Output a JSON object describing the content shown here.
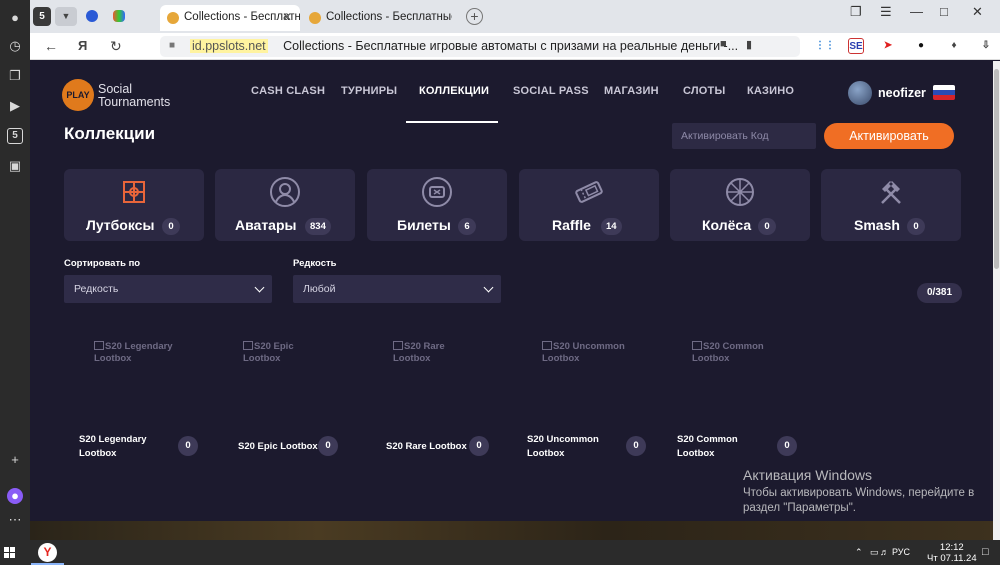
{
  "browser": {
    "sidebar": {
      "badge_label": "5"
    },
    "tabs": [
      {
        "title": "Collections - Бесплатн"
      },
      {
        "title": "Collections - Бесплатные и"
      }
    ],
    "mini_tab_label": "5",
    "address": {
      "domain": "id.ppslots.net",
      "page_title": "Collections - Бесплатные игровые автоматы с призами на реальные деньги -..."
    },
    "extensions": {
      "se_label": "SE"
    }
  },
  "site": {
    "logo": {
      "badge": "PLAY",
      "line1": "Social",
      "line2": "Tournaments"
    },
    "nav": [
      {
        "label": "CASH CLASH"
      },
      {
        "label": "ТУРНИРЫ"
      },
      {
        "label": "КОЛЛЕКЦИИ",
        "active": true
      },
      {
        "label": "SOCIAL PASS"
      },
      {
        "label": "МАГАЗИН"
      },
      {
        "label": "СЛОТЫ"
      },
      {
        "label": "КАЗИНО"
      }
    ],
    "user": {
      "name": "neofizer"
    },
    "page_title": "Коллекции",
    "code": {
      "placeholder": "Активировать Код",
      "button": "Активировать"
    },
    "categories": [
      {
        "label": "Лутбоксы",
        "count": "0",
        "icon": "lootbox-icon"
      },
      {
        "label": "Аватары",
        "count": "834",
        "icon": "avatar-icon"
      },
      {
        "label": "Билеты",
        "count": "6",
        "icon": "ticket-icon"
      },
      {
        "label": "Raffle",
        "count": "14",
        "icon": "raffle-ticket-icon"
      },
      {
        "label": "Колёса",
        "count": "0",
        "icon": "wheel-icon"
      },
      {
        "label": "Smash",
        "count": "0",
        "icon": "hammers-icon"
      }
    ],
    "filters": {
      "sort": {
        "label": "Сортировать по",
        "value": "Редкость"
      },
      "rarity": {
        "label": "Редкость",
        "value": "Любой"
      }
    },
    "collected": "0/381",
    "items": [
      {
        "alt": "S20 Legendary Lootbox",
        "name": "S20 Legendary Lootbox",
        "count": "0"
      },
      {
        "alt": "S20 Epic Lootbox",
        "name": "S20 Epic Lootbox",
        "count": "0"
      },
      {
        "alt": "S20 Rare Lootbox",
        "name": "S20 Rare Lootbox",
        "count": "0"
      },
      {
        "alt": "S20 Uncommon Lootbox",
        "name": "S20 Uncommon Lootbox",
        "count": "0"
      },
      {
        "alt": "S20 Common Lootbox",
        "name": "S20 Common Lootbox",
        "count": "0"
      }
    ]
  },
  "windows_activation": {
    "title": "Активация Windows",
    "line1": "Чтобы активировать Windows, перейдите в",
    "line2": "раздел \"Параметры\"."
  },
  "taskbar": {
    "lang": "РУС",
    "time": "12:12",
    "date": "Чт 07.11.24"
  },
  "colors": {
    "accent": "#f06e24",
    "background": "#1c1a2e",
    "card": "#2b2842"
  }
}
